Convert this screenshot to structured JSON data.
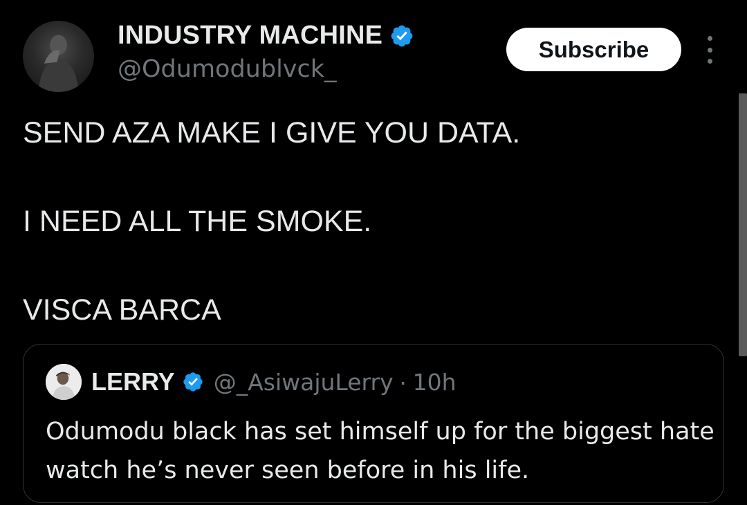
{
  "author": {
    "display_name": "INDUSTRY MACHINE",
    "handle": "@Odumodublvck_",
    "verified_icon": "verified-badge-icon",
    "avatar_icon": "avatar"
  },
  "actions": {
    "subscribe_label": "Subscribe",
    "more_icon": "more-vertical-icon"
  },
  "tweet": {
    "paragraphs": [
      "SEND AZA MAKE I GIVE YOU DATA.",
      "I NEED ALL THE SMOKE.",
      "VISCA BARCA"
    ]
  },
  "quoted_tweet": {
    "display_name": "LERRY",
    "handle": "@_AsiwajuLerry",
    "separator": "·",
    "time": "10h",
    "text": "Odumodu black has set himself up for the biggest hate watch he’s never seen before in his life."
  },
  "colors": {
    "background": "#000000",
    "text_primary": "#e7e9ea",
    "text_secondary": "#71767b",
    "verified_blue": "#1d9bf0",
    "border": "#2f3336",
    "button_bg": "#ffffff"
  }
}
